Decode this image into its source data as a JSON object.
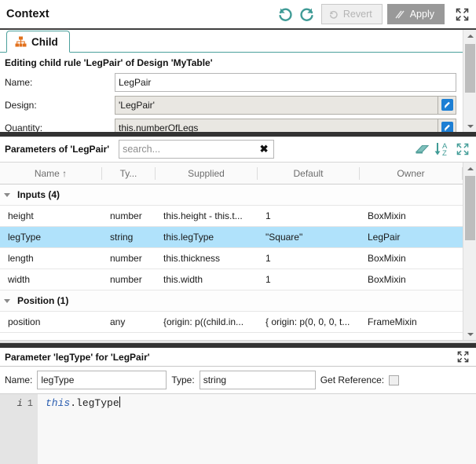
{
  "header": {
    "title": "Context",
    "undo_icon": "undo-icon",
    "redo_icon": "redo-icon",
    "revert_label": "Revert",
    "apply_label": "Apply",
    "maximize_icon": "maximize-icon"
  },
  "child_panel": {
    "tab": {
      "label": "Child",
      "icon": "hierarchy-icon"
    },
    "subtitle": "Editing child rule 'LegPair' of Design 'MyTable'",
    "fields": [
      {
        "label": "Name:",
        "value": "LegPair",
        "readonly": false,
        "has_edit_button": false
      },
      {
        "label": "Design:",
        "value": "'LegPair'",
        "readonly": true,
        "has_edit_button": true
      },
      {
        "label": "Quantity:",
        "value": "this.numberOfLegs",
        "readonly": true,
        "has_edit_button": true
      }
    ]
  },
  "params": {
    "title": "Parameters of 'LegPair'",
    "search": {
      "value": "",
      "placeholder": "search..."
    },
    "clear_label": "✖",
    "tools": [
      "eraser-icon",
      "sort-az-icon",
      "maximize-icon"
    ],
    "columns": [
      "Name",
      "Ty...",
      "Supplied",
      "Default",
      "Owner"
    ],
    "sort_indicator": "↑",
    "rows": [
      {
        "kind": "group",
        "label": "Inputs (4)"
      },
      {
        "kind": "data",
        "selected": false,
        "name": "height",
        "type": "number",
        "supplied": "this.height - this.t...",
        "default": "1",
        "owner": "BoxMixin"
      },
      {
        "kind": "data",
        "selected": true,
        "name": "legType",
        "type": "string",
        "supplied": "this.legType",
        "default": "\"Square\"",
        "owner": "LegPair"
      },
      {
        "kind": "data",
        "selected": false,
        "name": "length",
        "type": "number",
        "supplied": "this.thickness",
        "default": "1",
        "owner": "BoxMixin"
      },
      {
        "kind": "data",
        "selected": false,
        "name": "width",
        "type": "number",
        "supplied": "this.width",
        "default": "1",
        "owner": "BoxMixin"
      },
      {
        "kind": "group",
        "label": "Position (1)"
      },
      {
        "kind": "data",
        "selected": false,
        "name": "position",
        "type": "any",
        "supplied": "{origin: p((child.in...",
        "default": "{ origin: p(0, 0, 0, t...",
        "owner": "FrameMixin"
      }
    ]
  },
  "detail": {
    "title": "Parameter 'legType' for 'LegPair'",
    "maximize_icon": "maximize-icon",
    "name_label": "Name:",
    "name_value": "legType",
    "type_label": "Type:",
    "type_value": "string",
    "get_reference_label": "Get Reference:",
    "get_reference_checked": false,
    "code": {
      "info_marker": "i",
      "line_number": "1",
      "keyword": "this",
      "rest": ".legType"
    }
  },
  "colors": {
    "accent_teal": "#4ba09c",
    "selection_blue": "#b0e2fb",
    "apply_gray": "#999999",
    "tab_icon_orange": "#e2711d",
    "edit_blue": "#1d7fd4"
  }
}
